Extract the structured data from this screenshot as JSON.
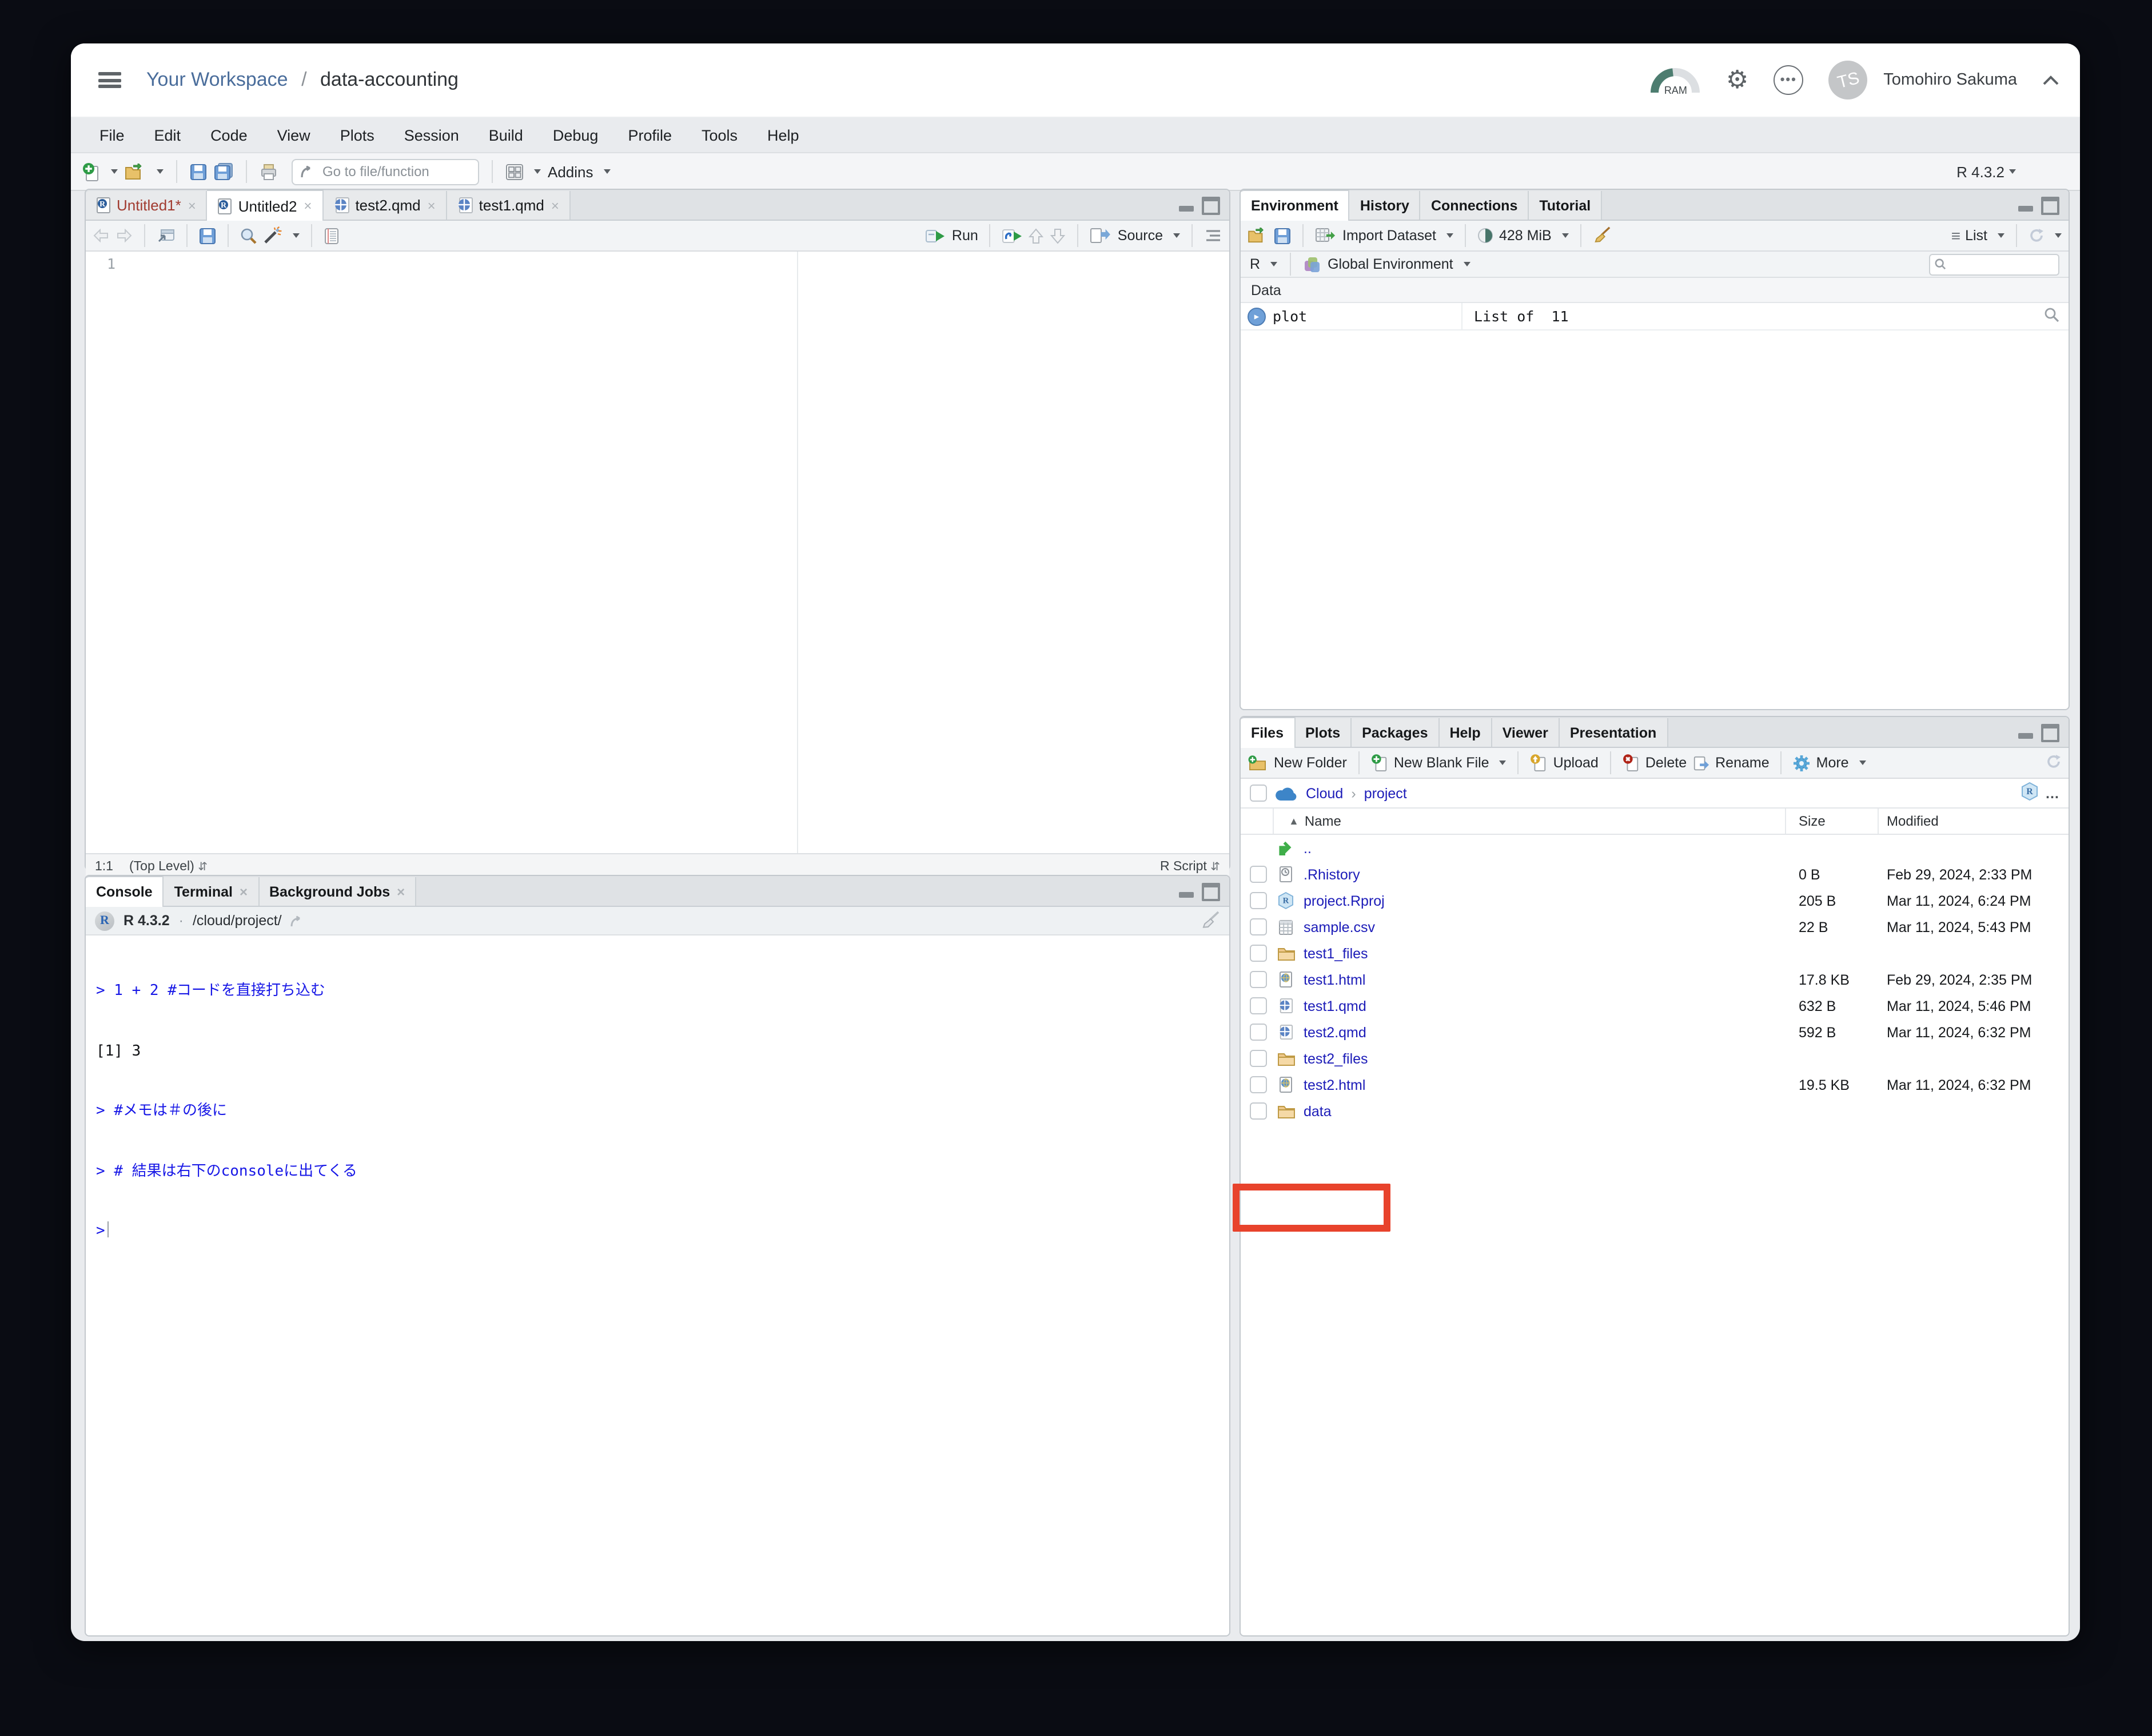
{
  "titlebar": {
    "workspace": "Your Workspace",
    "separator": "/",
    "project": "data-accounting",
    "ram_label": "RAM",
    "user": {
      "initials": "TS",
      "name": "Tomohiro Sakuma"
    }
  },
  "menu": {
    "items": [
      "File",
      "Edit",
      "Code",
      "View",
      "Plots",
      "Session",
      "Build",
      "Debug",
      "Profile",
      "Tools",
      "Help"
    ]
  },
  "toolbar": {
    "goto_placeholder": "Go to file/function",
    "addins_label": "Addins",
    "r_version": "R 4.3.2"
  },
  "source": {
    "tabs": [
      {
        "label": "Untitled1*"
      },
      {
        "label": "Untitled2"
      },
      {
        "label": "test2.qmd"
      },
      {
        "label": "test1.qmd"
      }
    ],
    "run_label": "Run",
    "source_label": "Source",
    "line_number": "1",
    "status": {
      "position": "1:1",
      "scope": "(Top Level)",
      "file_type": "R Script"
    }
  },
  "environment": {
    "tabs": [
      {
        "label": "Environment"
      },
      {
        "label": "History"
      },
      {
        "label": "Connections"
      },
      {
        "label": "Tutorial"
      }
    ],
    "import_label": "Import Dataset",
    "memory_label": "428 MiB",
    "list_label": "List",
    "lang_label": "R",
    "env_label": "Global Environment",
    "section_label": "Data",
    "objects": [
      {
        "name": "plot",
        "value": "List of  11"
      }
    ]
  },
  "files": {
    "tabs": [
      {
        "label": "Files"
      },
      {
        "label": "Plots"
      },
      {
        "label": "Packages"
      },
      {
        "label": "Help"
      },
      {
        "label": "Viewer"
      },
      {
        "label": "Presentation"
      }
    ],
    "toolbar": {
      "new_folder": "New Folder",
      "new_blank_file": "New Blank File",
      "upload": "Upload",
      "delete": "Delete",
      "rename": "Rename",
      "more": "More"
    },
    "breadcrumb": {
      "root": "Cloud",
      "folder": "project"
    },
    "columns": {
      "name": "Name",
      "size": "Size",
      "modified": "Modified"
    },
    "rows": [
      {
        "name": "..",
        "size": "",
        "modified": ""
      },
      {
        "name": ".Rhistory",
        "size": "0 B",
        "modified": "Feb 29, 2024, 2:33 PM"
      },
      {
        "name": "project.Rproj",
        "size": "205 B",
        "modified": "Mar 11, 2024, 6:24 PM"
      },
      {
        "name": "sample.csv",
        "size": "22 B",
        "modified": "Mar 11, 2024, 5:43 PM"
      },
      {
        "name": "test1_files",
        "size": "",
        "modified": ""
      },
      {
        "name": "test1.html",
        "size": "17.8 KB",
        "modified": "Feb 29, 2024, 2:35 PM"
      },
      {
        "name": "test1.qmd",
        "size": "632 B",
        "modified": "Mar 11, 2024, 5:46 PM"
      },
      {
        "name": "test2.qmd",
        "size": "592 B",
        "modified": "Mar 11, 2024, 6:32 PM"
      },
      {
        "name": "test2_files",
        "size": "",
        "modified": ""
      },
      {
        "name": "test2.html",
        "size": "19.5 KB",
        "modified": "Mar 11, 2024, 6:32 PM"
      },
      {
        "name": "data",
        "size": "",
        "modified": ""
      }
    ]
  },
  "console": {
    "tabs": [
      {
        "label": "Console"
      },
      {
        "label": "Terminal"
      },
      {
        "label": "Background Jobs"
      }
    ],
    "info": {
      "r_version": "R 4.3.2",
      "dot": "·",
      "path": "/cloud/project/"
    },
    "lines": [
      {
        "text": "> 1 + 2 #コードを直接打ち込む"
      },
      {
        "text": "[1] 3"
      },
      {
        "text": "> #メモは＃の後に"
      },
      {
        "text": "> # 結果は右下のconsoleに出てくる"
      },
      {
        "text": ">"
      }
    ]
  },
  "colors": {
    "accent_link": "#1c1cb8",
    "annotation_red": "#e8432c",
    "ram_teal": "#4d7d70",
    "unsaved_red": "#a13b30"
  }
}
